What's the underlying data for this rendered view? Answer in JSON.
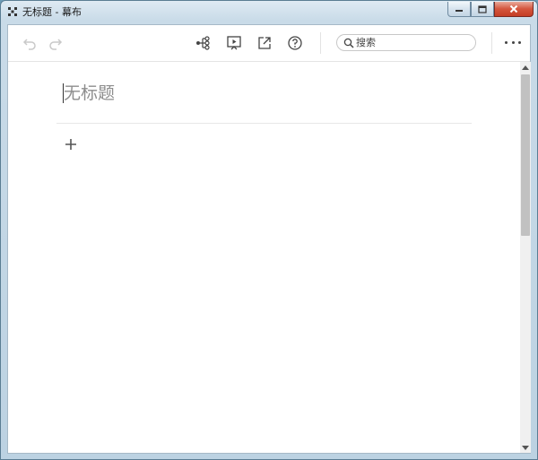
{
  "window": {
    "title": "无标题 - 幕布",
    "icons": {
      "app": "mubu-logo-icon",
      "minimize": "minimize-icon",
      "maximize": "maximize-icon",
      "close": "close-icon"
    }
  },
  "toolbar": {
    "undo_icon": "undo-icon",
    "redo_icon": "redo-icon",
    "mindmap_icon": "mindmap-icon",
    "present_icon": "presentation-icon",
    "export_icon": "export-icon",
    "help_icon": "help-icon",
    "search": {
      "placeholder": "搜索",
      "value": ""
    },
    "more_icon": "more-icon"
  },
  "document": {
    "title_placeholder": "无标题",
    "add_icon": "plus-icon"
  },
  "colors": {
    "accent": "#c43d24",
    "icon": "#444444",
    "disabled_icon": "#c9c9c9"
  }
}
